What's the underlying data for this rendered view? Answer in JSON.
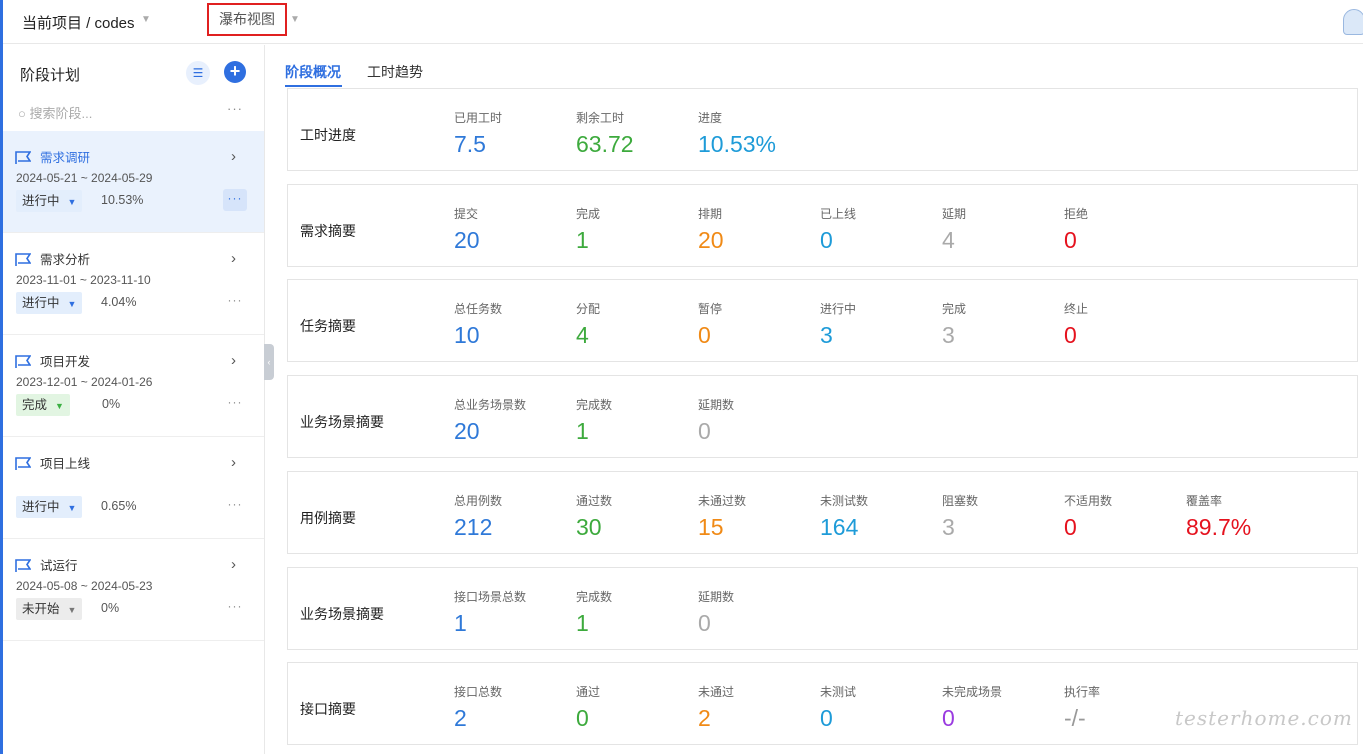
{
  "header": {
    "breadcrumb": "当前项目 / codes",
    "view_button": "瀑布视图"
  },
  "sidebar": {
    "title": "阶段计划",
    "search_placeholder": "搜索阶段...",
    "phases": [
      {
        "name": "需求调研",
        "dates": "2024-05-21 ~ 2024-05-29",
        "status": "进行中",
        "status_color": "blue",
        "progress": "10.53%",
        "active": true
      },
      {
        "name": "需求分析",
        "dates": "2023-11-01 ~ 2023-11-10",
        "status": "进行中",
        "status_color": "blue",
        "progress": "4.04%",
        "active": false
      },
      {
        "name": "项目开发",
        "dates": "2023-12-01 ~ 2024-01-26",
        "status": "完成",
        "status_color": "green",
        "progress": "0%",
        "active": false
      },
      {
        "name": "项目上线",
        "dates": "",
        "status": "进行中",
        "status_color": "blue",
        "progress": "0.65%",
        "active": false
      },
      {
        "name": "试运行",
        "dates": "2024-05-08 ~ 2024-05-23",
        "status": "未开始",
        "status_color": "gray",
        "progress": "0%",
        "active": false
      }
    ]
  },
  "tabs": [
    "阶段概况",
    "工时趋势"
  ],
  "cards": [
    {
      "title": "工时进度",
      "metrics": [
        {
          "label": "已用工时",
          "value": "7.5",
          "color": "#2f79d8"
        },
        {
          "label": "剩余工时",
          "value": "63.72",
          "color": "#3daa3d"
        },
        {
          "label": "进度",
          "value": "10.53%",
          "color": "#1e9bd8"
        }
      ]
    },
    {
      "title": "需求摘要",
      "metrics": [
        {
          "label": "提交",
          "value": "20",
          "color": "#2f79d8"
        },
        {
          "label": "完成",
          "value": "1",
          "color": "#3daa3d"
        },
        {
          "label": "排期",
          "value": "20",
          "color": "#f08a16"
        },
        {
          "label": "已上线",
          "value": "0",
          "color": "#1e9bd8"
        },
        {
          "label": "延期",
          "value": "4",
          "color": "#aaaaaa"
        },
        {
          "label": "拒绝",
          "value": "0",
          "color": "#e5121e"
        }
      ]
    },
    {
      "title": "任务摘要",
      "metrics": [
        {
          "label": "总任务数",
          "value": "10",
          "color": "#2f79d8"
        },
        {
          "label": "分配",
          "value": "4",
          "color": "#3daa3d"
        },
        {
          "label": "暂停",
          "value": "0",
          "color": "#f08a16"
        },
        {
          "label": "进行中",
          "value": "3",
          "color": "#1e9bd8"
        },
        {
          "label": "完成",
          "value": "3",
          "color": "#aaaaaa"
        },
        {
          "label": "终止",
          "value": "0",
          "color": "#e5121e"
        }
      ]
    },
    {
      "title": "业务场景摘要",
      "metrics": [
        {
          "label": "总业务场景数",
          "value": "20",
          "color": "#2f79d8"
        },
        {
          "label": "完成数",
          "value": "1",
          "color": "#3daa3d"
        },
        {
          "label": "延期数",
          "value": "0",
          "color": "#aaaaaa"
        }
      ]
    },
    {
      "title": "用例摘要",
      "metrics": [
        {
          "label": "总用例数",
          "value": "212",
          "color": "#2f79d8"
        },
        {
          "label": "通过数",
          "value": "30",
          "color": "#3daa3d"
        },
        {
          "label": "未通过数",
          "value": "15",
          "color": "#f08a16"
        },
        {
          "label": "未测试数",
          "value": "164",
          "color": "#1e9bd8"
        },
        {
          "label": "阻塞数",
          "value": "3",
          "color": "#aaaaaa"
        },
        {
          "label": "不适用数",
          "value": "0",
          "color": "#e5121e"
        },
        {
          "label": "覆盖率",
          "value": "89.7%",
          "color": "#e5121e"
        }
      ]
    },
    {
      "title": "业务场景摘要",
      "metrics": [
        {
          "label": "接口场景总数",
          "value": "1",
          "color": "#2f79d8"
        },
        {
          "label": "完成数",
          "value": "1",
          "color": "#3daa3d"
        },
        {
          "label": "延期数",
          "value": "0",
          "color": "#aaaaaa"
        }
      ]
    },
    {
      "title": "接口摘要",
      "metrics": [
        {
          "label": "接口总数",
          "value": "2",
          "color": "#2f79d8"
        },
        {
          "label": "通过",
          "value": "0",
          "color": "#3daa3d"
        },
        {
          "label": "未通过",
          "value": "2",
          "color": "#f08a16"
        },
        {
          "label": "未测试",
          "value": "0",
          "color": "#1e9bd8"
        },
        {
          "label": "未完成场景",
          "value": "0",
          "color": "#9a3be0"
        },
        {
          "label": "执行率",
          "value": "-/-",
          "color": "#999999"
        }
      ]
    }
  ],
  "watermark": "testerhome.com",
  "icons": {
    "avatar": "user-avatar-icon",
    "list": "list-icon",
    "add": "plus-icon",
    "search": "search-icon",
    "flag": "flag-icon",
    "chevron": "chevron-right-icon",
    "more": "more-dots-icon",
    "collapse": "chevron-left-icon"
  }
}
